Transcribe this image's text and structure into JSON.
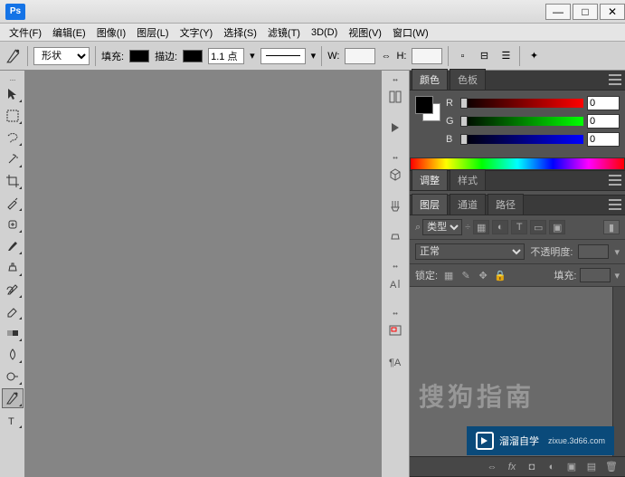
{
  "app": {
    "logo": "Ps"
  },
  "menu": [
    "文件(F)",
    "编辑(E)",
    "图像(I)",
    "图层(L)",
    "文字(Y)",
    "选择(S)",
    "滤镜(T)",
    "3D(D)",
    "视图(V)",
    "窗口(W)"
  ],
  "options": {
    "mode": "形状",
    "fill_label": "填充:",
    "stroke_label": "描边:",
    "stroke_width": "1.1 点",
    "w_label": "W:",
    "h_label": "H:"
  },
  "color_panel": {
    "tab_color": "颜色",
    "tab_swatches": "色板",
    "r_label": "R",
    "r_value": "0",
    "g_label": "G",
    "g_value": "0",
    "b_label": "B",
    "b_value": "0"
  },
  "adjust_panel": {
    "tab_adjust": "调整",
    "tab_styles": "样式"
  },
  "layers_panel": {
    "tab_layers": "图层",
    "tab_channels": "通道",
    "tab_paths": "路径",
    "kind_label": "类型",
    "blend_mode": "正常",
    "opacity_label": "不透明度:",
    "opacity_value": "",
    "lock_label": "锁定:",
    "fill_label": "填充:",
    "fill_value": ""
  },
  "watermark": {
    "text1": "搜狗指南",
    "text2": "溜溜自学",
    "sub": "zixue.3d66.com"
  }
}
